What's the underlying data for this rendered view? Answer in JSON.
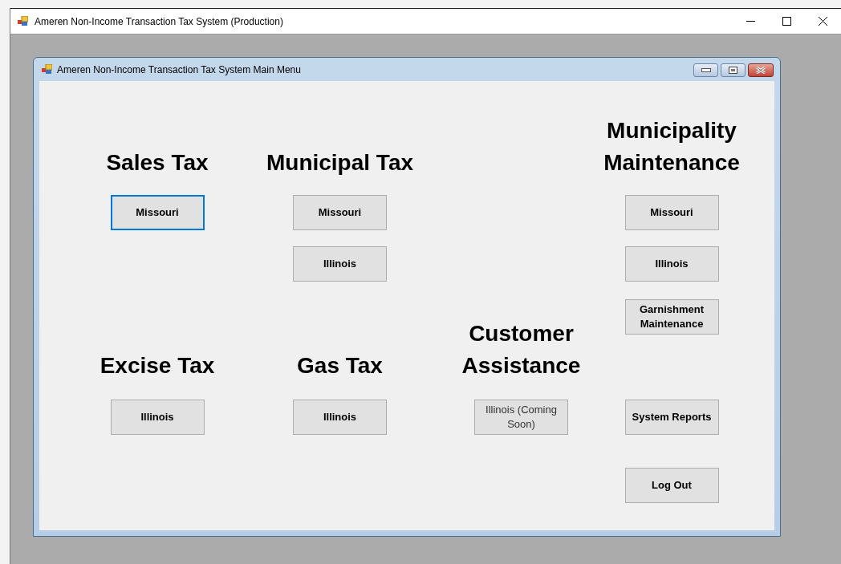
{
  "window": {
    "title": "Ameren Non-Income Transaction Tax System (Production)"
  },
  "child_window": {
    "title": "Ameren Non-Income Transaction Tax System Main Menu"
  },
  "sections": [
    {
      "heading": "Sales Tax",
      "buttons": [
        {
          "label": "Missouri",
          "focused": true,
          "disabled": false
        }
      ]
    },
    {
      "heading": "Municipal Tax",
      "buttons": [
        {
          "label": "Missouri",
          "focused": false,
          "disabled": false
        },
        {
          "label": "Illinois",
          "focused": false,
          "disabled": false
        }
      ]
    },
    {
      "heading": "Municipality Maintenance",
      "buttons": [
        {
          "label": "Missouri",
          "focused": false,
          "disabled": false
        },
        {
          "label": "Illinois",
          "focused": false,
          "disabled": false
        },
        {
          "label": "Garnishment Maintenance",
          "focused": false,
          "disabled": false
        }
      ]
    },
    {
      "heading": "Excise Tax",
      "buttons": [
        {
          "label": "Illinois",
          "focused": false,
          "disabled": false
        }
      ]
    },
    {
      "heading": "Gas Tax",
      "buttons": [
        {
          "label": "Illinois",
          "focused": false,
          "disabled": false
        }
      ]
    },
    {
      "heading": "Customer Assistance",
      "buttons": [
        {
          "label": "Illinois (Coming Soon)",
          "focused": false,
          "disabled": true
        }
      ]
    }
  ],
  "buttons": [
    {
      "label": "System Reports",
      "focused": false,
      "disabled": false
    },
    {
      "label": "Log Out",
      "focused": false,
      "disabled": false
    }
  ]
}
